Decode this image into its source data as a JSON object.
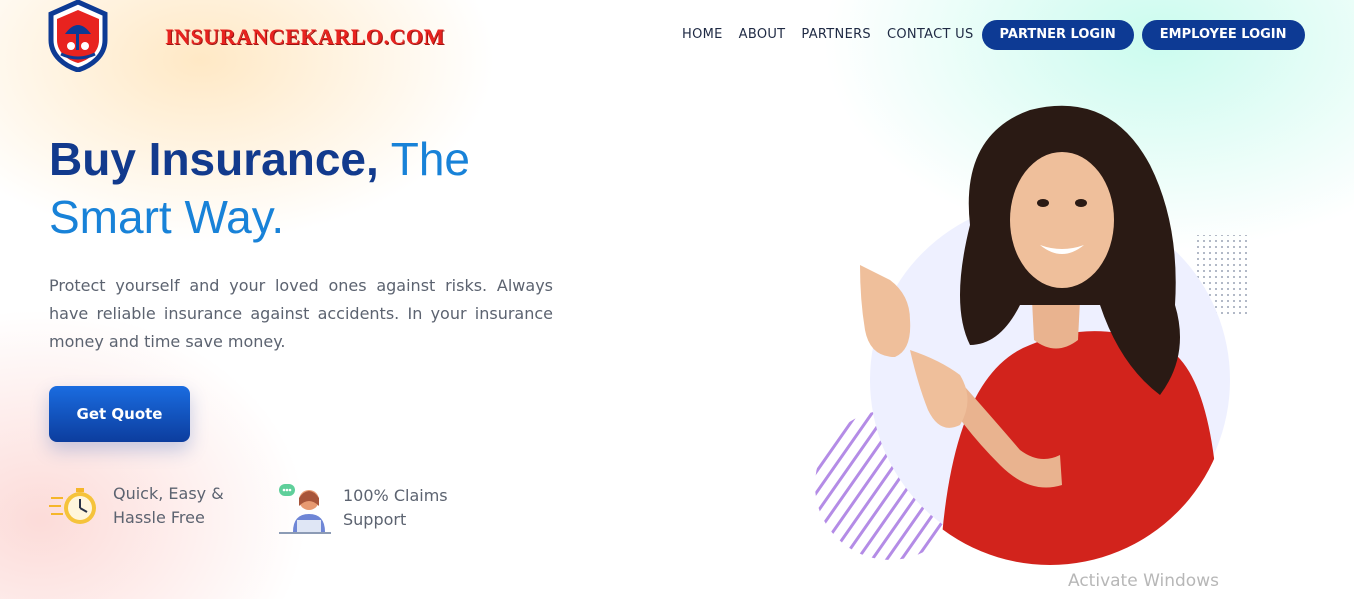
{
  "brand": {
    "name": "INSURANCEKARLO.COM"
  },
  "nav": {
    "links": [
      "HOME",
      "ABOUT",
      "PARTNERS",
      "CONTACT US"
    ],
    "buttons": [
      "PARTNER LOGIN",
      "EMPLOYEE LOGIN"
    ]
  },
  "hero": {
    "title_bold": "Buy Insurance,",
    "title_light_1": "The",
    "title_light_2": "Smart Way.",
    "description": "Protect yourself and your loved ones against risks. Always have reliable insurance against accidents. In your insurance money and time save money.",
    "cta_label": "Get Quote"
  },
  "features": [
    {
      "line1": "Quick, Easy &",
      "line2": "Hassle Free",
      "icon": "clock-icon"
    },
    {
      "line1": "100% Claims",
      "line2": "Support",
      "icon": "support-agent-icon"
    }
  ],
  "watermark": "Activate Windows",
  "colors": {
    "primary": "#0d3a94",
    "accent": "#1882d8",
    "brand_red": "#e8231f",
    "shirt_red": "#d2231c"
  }
}
